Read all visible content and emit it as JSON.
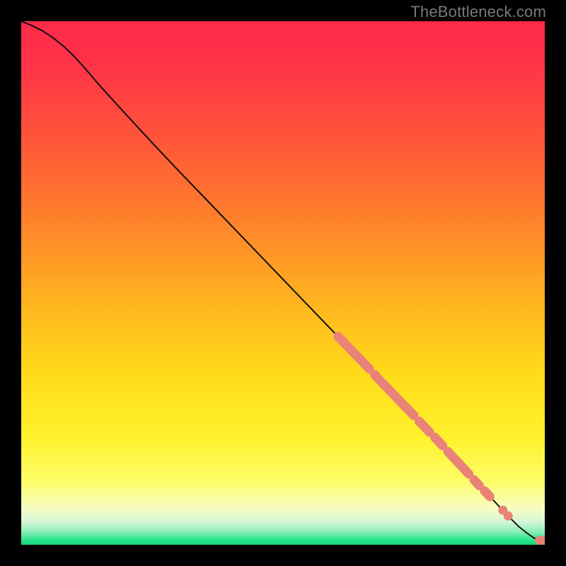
{
  "attribution": "TheBottleneck.com",
  "colors": {
    "background_black": "#000000",
    "gradient_stops": [
      {
        "offset": 0.0,
        "color": "#ff2a4a"
      },
      {
        "offset": 0.08,
        "color": "#ff3248"
      },
      {
        "offset": 0.18,
        "color": "#ff4a3e"
      },
      {
        "offset": 0.3,
        "color": "#ff6a32"
      },
      {
        "offset": 0.42,
        "color": "#ff8e28"
      },
      {
        "offset": 0.55,
        "color": "#ffb81e"
      },
      {
        "offset": 0.68,
        "color": "#ffdd1a"
      },
      {
        "offset": 0.8,
        "color": "#fff22e"
      },
      {
        "offset": 0.88,
        "color": "#fdfd6a"
      },
      {
        "offset": 0.93,
        "color": "#f7fcc2"
      },
      {
        "offset": 0.955,
        "color": "#d8f6d8"
      },
      {
        "offset": 0.975,
        "color": "#8ceeb8"
      },
      {
        "offset": 0.99,
        "color": "#2de58f"
      },
      {
        "offset": 1.0,
        "color": "#14d977"
      }
    ],
    "curve_stroke": "#101010",
    "marker_fill": "#e98378",
    "marker_stroke": "#b35b51"
  },
  "chart_data": {
    "type": "line",
    "title": "",
    "xlabel": "",
    "ylabel": "",
    "xlim": [
      0,
      100
    ],
    "ylim": [
      0,
      100
    ],
    "grid": false,
    "legend": false,
    "series": [
      {
        "name": "curve",
        "x": [
          0,
          2,
          4,
          6,
          8,
          10,
          12,
          15,
          20,
          25,
          30,
          35,
          40,
          45,
          50,
          55,
          60,
          65,
          70,
          75,
          80,
          85,
          90,
          93,
          95,
          96.5,
          97.5,
          98.2,
          99,
          100
        ],
        "y": [
          100,
          99.2,
          98.2,
          96.9,
          95.3,
          93.4,
          91.2,
          87.7,
          82.2,
          76.8,
          71.5,
          66.3,
          61.1,
          55.9,
          50.7,
          45.5,
          40.3,
          35.1,
          29.9,
          24.7,
          19.4,
          14.1,
          8.7,
          5.5,
          3.5,
          2.3,
          1.6,
          1.15,
          0.85,
          0.85
        ]
      }
    ],
    "markers": {
      "name": "points",
      "shape": "round",
      "fill": "#e98378",
      "segments": [
        {
          "x0": 60.5,
          "y0": 39.8,
          "x1": 66.5,
          "y1": 33.6
        },
        {
          "x0": 67.5,
          "y0": 32.5,
          "x1": 68.5,
          "y1": 31.4
        },
        {
          "x0": 69.0,
          "y0": 30.9,
          "x1": 75.0,
          "y1": 24.7
        },
        {
          "x0": 76.0,
          "y0": 23.6,
          "x1": 78.0,
          "y1": 21.5
        },
        {
          "x0": 79.0,
          "y0": 20.5,
          "x1": 80.5,
          "y1": 18.9
        },
        {
          "x0": 81.5,
          "y0": 17.8,
          "x1": 85.5,
          "y1": 13.5
        },
        {
          "x0": 86.5,
          "y0": 12.4,
          "x1": 87.5,
          "y1": 11.3
        },
        {
          "x0": 88.5,
          "y0": 10.3,
          "x1": 89.5,
          "y1": 9.2
        }
      ],
      "dots": [
        {
          "x": 92.0,
          "y": 6.6
        },
        {
          "x": 93.0,
          "y": 5.5
        },
        {
          "x": 99.0,
          "y": 0.85
        },
        {
          "x": 100.0,
          "y": 0.85
        }
      ]
    }
  }
}
